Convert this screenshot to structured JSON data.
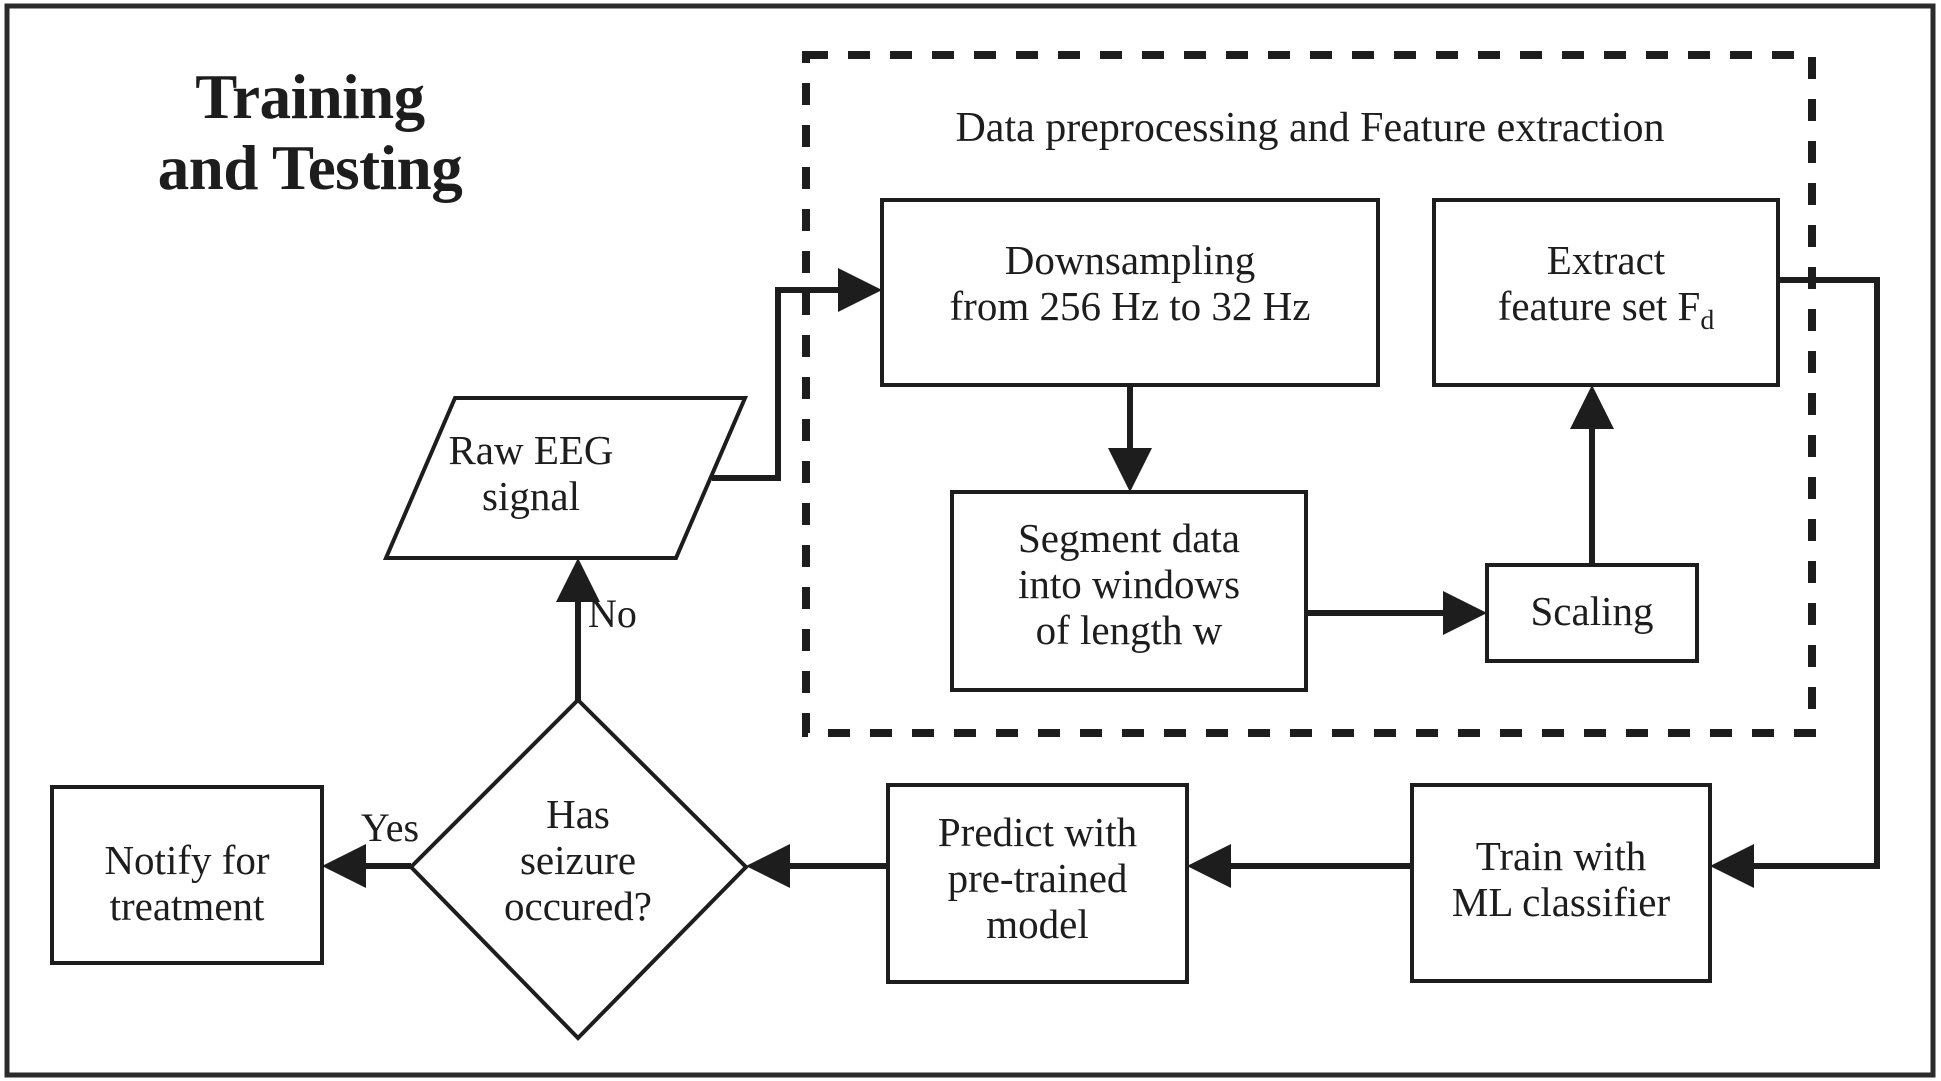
{
  "diagram": {
    "title": "Training\nand Testing",
    "group_box": {
      "label": "Data preprocessing and Feature extraction"
    },
    "nodes": {
      "raw_eeg": {
        "label": "Raw EEG\nsignal",
        "shape": "parallelogram"
      },
      "downsampling": {
        "label": "Downsampling\nfrom 256 Hz to 32 Hz",
        "shape": "rectangle"
      },
      "segment": {
        "label": "Segment data\ninto windows\nof length w",
        "shape": "rectangle"
      },
      "scaling": {
        "label": "Scaling",
        "shape": "rectangle"
      },
      "extract": {
        "label_line1": "Extract",
        "label_line2_pre": "feature set F",
        "label_line2_sub": "d",
        "shape": "rectangle"
      },
      "train": {
        "label": "Train with\nML classifier",
        "shape": "rectangle"
      },
      "predict": {
        "label": "Predict with\npre-trained\nmodel",
        "shape": "rectangle"
      },
      "decision": {
        "label": "Has\nseizure\noccured?",
        "shape": "diamond"
      },
      "notify": {
        "label": "Notify for\ntreatment",
        "shape": "rectangle"
      }
    },
    "edge_labels": {
      "yes": "Yes",
      "no": "No"
    },
    "colors": {
      "stroke": "#1d1d1d",
      "fill": "#ffffff",
      "frame": "#2b2b2b"
    }
  }
}
